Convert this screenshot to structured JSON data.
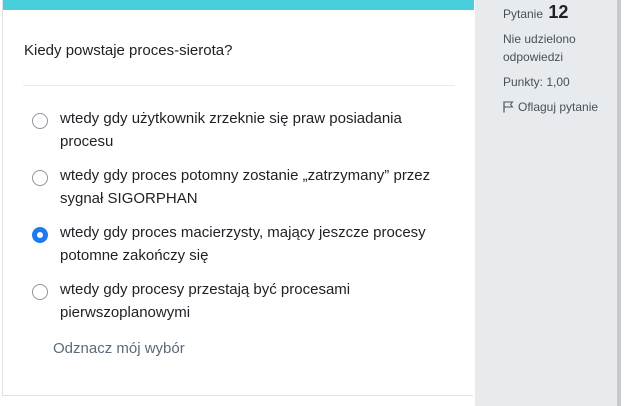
{
  "question": {
    "text": "Kiedy powstaje proces-sierota?",
    "answers": [
      {
        "label": "wtedy gdy użytkownik zrzeknie się praw posiadania procesu",
        "selected": false
      },
      {
        "label": "wtedy gdy proces potomny zostanie „zatrzymany” przez sygnał SIGORPHAN",
        "selected": false
      },
      {
        "label": "wtedy gdy proces macierzysty, mający jeszcze procesy potomne zakończy się",
        "selected": true
      },
      {
        "label": "wtedy gdy procesy przestają być procesami pierwszoplanowymi",
        "selected": false
      }
    ],
    "clear_choice_label": "Odznacz mój wybór"
  },
  "info": {
    "question_label": "Pytanie",
    "question_number": "12",
    "state": "Nie udzielono odpowiedzi",
    "grade": "Punkty: 1,00",
    "flag_label": "Oflaguj pytanie"
  },
  "colors": {
    "accent_bar": "#48cfdb",
    "radio_selected": "#1f7af0",
    "info_panel_bg": "#e8ebee"
  },
  "icons": {
    "flag": "flag-icon"
  }
}
